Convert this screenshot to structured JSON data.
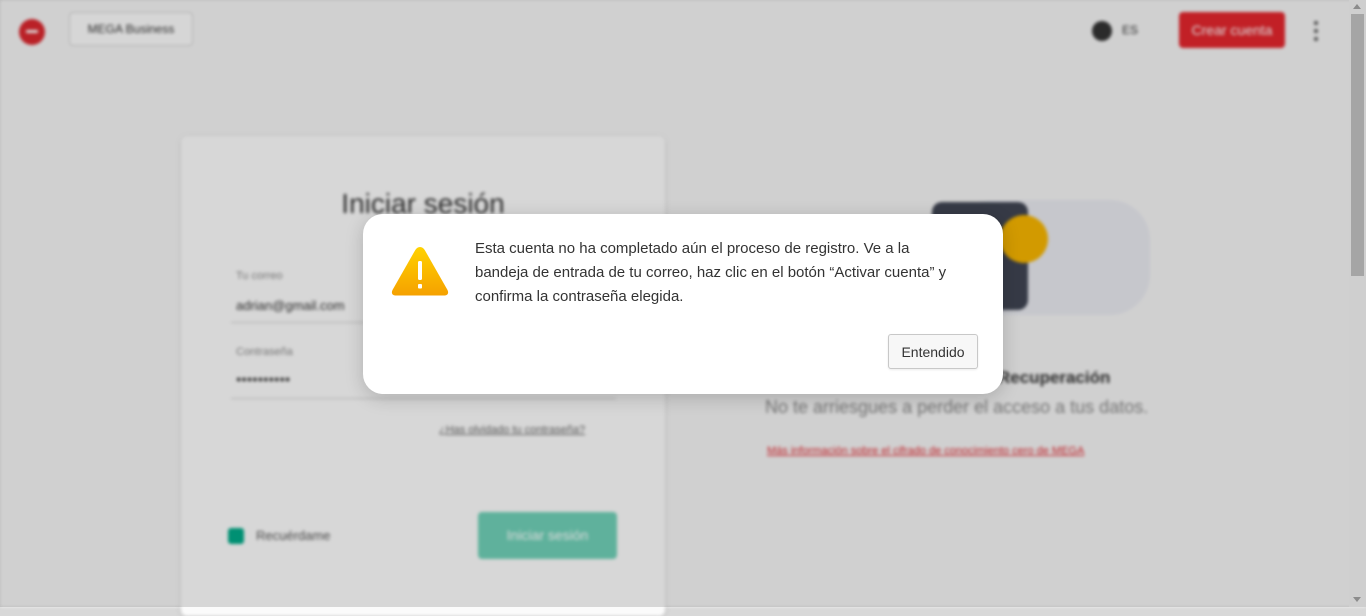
{
  "header": {
    "business_label": "MEGA Business",
    "language": "ES",
    "create_account_label": "Crear cuenta"
  },
  "login": {
    "title": "Iniciar sesión",
    "email_label": "Tu correo",
    "email_value": "adrian@gmail.com",
    "password_label": "Contraseña",
    "password_value": "●●●●●●●●●●",
    "forgot_label": "¿Has olvidado tu contraseña?",
    "remember_label": "Recuérdame",
    "submit_label": "Iniciar sesión"
  },
  "recovery": {
    "title": "Recuperación",
    "subtitle": "No te arriesgues a perder el acceso a tus datos.",
    "link": "Más información sobre el cifrado de conocimiento cero de MEGA"
  },
  "dialog": {
    "message": "Esta cuenta no ha completado aún el proceso de registro. Ve a la bandeja de entrada de tu correo, haz clic en el botón “Activar cuenta” y confirma la contraseña elegida.",
    "ok_label": "Entendido"
  },
  "colors": {
    "brand_red": "#d9272e",
    "accent_green": "#00a886",
    "warning_yellow": "#f5b400"
  },
  "icons": {
    "logo": "mega-logo-icon",
    "globe": "globe-icon",
    "menu": "kebab-menu-icon",
    "warning": "warning-triangle-icon"
  }
}
